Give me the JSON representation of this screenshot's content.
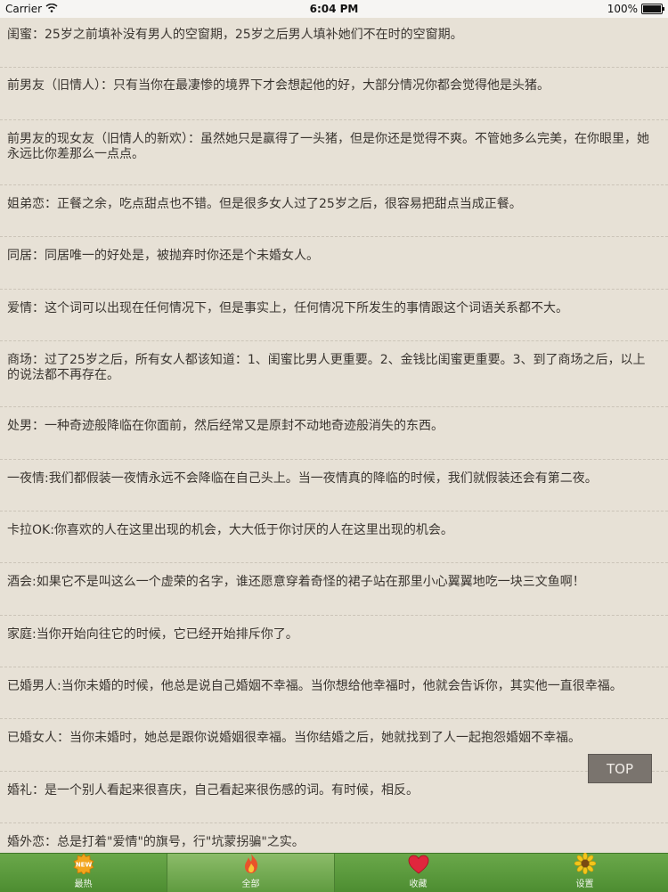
{
  "status_bar": {
    "carrier": "Carrier",
    "time": "6:04 PM",
    "battery": "100%"
  },
  "entries": [
    "闺蜜：25岁之前填补没有男人的空窗期，25岁之后男人填补她们不在时的空窗期。",
    "前男友（旧情人）：只有当你在最凄惨的境界下才会想起他的好，大部分情况你都会觉得他是头猪。",
    "前男友的现女友（旧情人的新欢）：虽然她只是赢得了一头猪，但是你还是觉得不爽。不管她多么完美，在你眼里，她永远比你差那么一点点。",
    "姐弟恋：正餐之余，吃点甜点也不错。但是很多女人过了25岁之后，很容易把甜点当成正餐。",
    "同居：同居唯一的好处是，被抛弃时你还是个未婚女人。",
    "爱情：这个词可以出现在任何情况下，但是事实上，任何情况下所发生的事情跟这个词语关系都不大。",
    "商场：过了25岁之后，所有女人都该知道：1、闺蜜比男人更重要。2、金钱比闺蜜更重要。3、到了商场之后，以上的说法都不再存在。",
    "处男：一种奇迹般降临在你面前，然后经常又是原封不动地奇迹般消失的东西。",
    "一夜情:我们都假装一夜情永远不会降临在自己头上。当一夜情真的降临的时候，我们就假装还会有第二夜。",
    "卡拉OK:你喜欢的人在这里出现的机会，大大低于你讨厌的人在这里出现的机会。",
    "酒会:如果它不是叫这么一个虚荣的名字，谁还愿意穿着奇怪的裙子站在那里小心翼翼地吃一块三文鱼啊！",
    "家庭:当你开始向往它的时候，它已经开始排斥你了。",
    "已婚男人:当你未婚的时候，他总是说自己婚姻不幸福。当你想给他幸福时，他就会告诉你，其实他一直很幸福。",
    "已婚女人：当你未婚时，她总是跟你说婚姻很幸福。当你结婚之后，她就找到了人一起抱怨婚姻不幸福。",
    "婚礼：是一个别人看起来很喜庆，自己看起来很伤感的词。有时候，相反。",
    "婚外恋：总是打着\"爱情\"的旗号，行\"坑蒙拐骗\"之实。"
  ],
  "top_button": "TOP",
  "tabs": [
    {
      "label": "最热",
      "icon": "new-badge-icon"
    },
    {
      "label": "全部",
      "icon": "flame-icon"
    },
    {
      "label": "收藏",
      "icon": "heart-icon"
    },
    {
      "label": "设置",
      "icon": "sunflower-icon"
    }
  ],
  "colors": {
    "background": "#e7e1d6",
    "tabbar": "#5a9a3b",
    "top_button": "#7a746e"
  }
}
